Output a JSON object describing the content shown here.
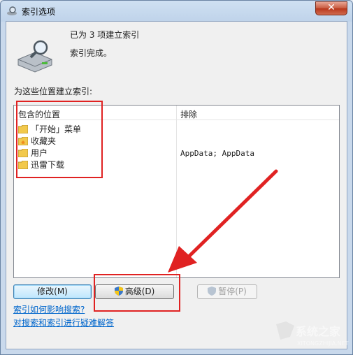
{
  "window": {
    "title": "索引选项",
    "close_glyph": "✕"
  },
  "status": {
    "count_text": "已为 3 项建立索引",
    "message": "索引完成。"
  },
  "section_label": "为这些位置建立索引:",
  "table": {
    "headers": [
      "包含的位置",
      "排除"
    ],
    "rows": [
      {
        "name": "「开始」菜单",
        "icon": "folder-icon",
        "exclude": ""
      },
      {
        "name": "收藏夹",
        "icon": "favorites-folder-icon",
        "exclude": ""
      },
      {
        "name": "用户",
        "icon": "folder-icon",
        "exclude": "AppData; AppData"
      },
      {
        "name": "迅雷下载",
        "icon": "folder-icon",
        "exclude": ""
      }
    ]
  },
  "buttons": {
    "modify": "修改(M)",
    "advanced": "高级(D)",
    "pause": "暂停(P)"
  },
  "links": {
    "how_affects": "索引如何影响搜索?",
    "troubleshoot": "对搜索和索引进行疑难解答"
  },
  "colors": {
    "annotation_red": "#e02222",
    "link_blue": "#0066cc"
  }
}
